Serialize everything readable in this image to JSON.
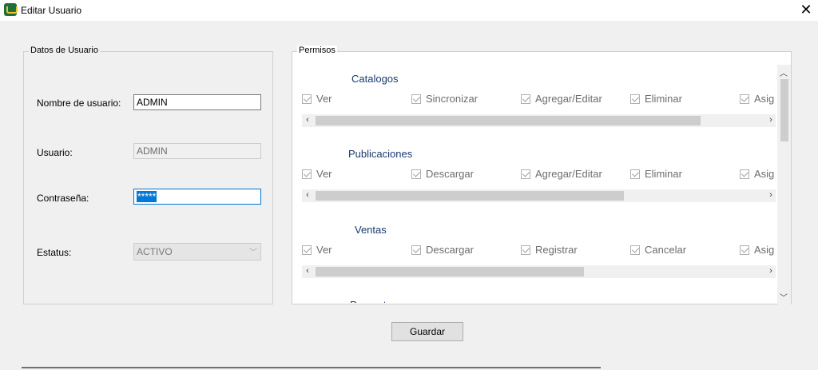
{
  "window": {
    "title": "Editar Usuario",
    "close": "✕"
  },
  "user_group": {
    "title": "Datos de Usuario",
    "fields": {
      "nombre_label": "Nombre de usuario:",
      "nombre_value": "ADMIN",
      "usuario_label": "Usuario:",
      "usuario_value": "ADMIN",
      "contrasena_label": "Contraseña:",
      "contrasena_value": "*****",
      "estatus_label": "Estatus:",
      "estatus_value": "ACTIVO"
    }
  },
  "perm_group": {
    "title": "Permisos",
    "sections": [
      {
        "title": "Catalogos",
        "items": [
          "Ver",
          "Sincronizar",
          "Agregar/Editar",
          "Eliminar",
          "Asig"
        ],
        "thumb_fraction": 0.86
      },
      {
        "title": "Publicaciones",
        "items": [
          "Ver",
          "Descargar",
          "Agregar/Editar",
          "Eliminar",
          "Asig"
        ],
        "thumb_fraction": 0.69
      },
      {
        "title": "Ventas",
        "items": [
          "Ver",
          "Descargar",
          "Registrar",
          "Cancelar",
          "Asig"
        ],
        "thumb_fraction": 0.6
      },
      {
        "title": "Preguntas"
      }
    ]
  },
  "buttons": {
    "save": "Guardar"
  },
  "icons": {
    "app": "cart-app-icon",
    "check": "check-icon"
  }
}
